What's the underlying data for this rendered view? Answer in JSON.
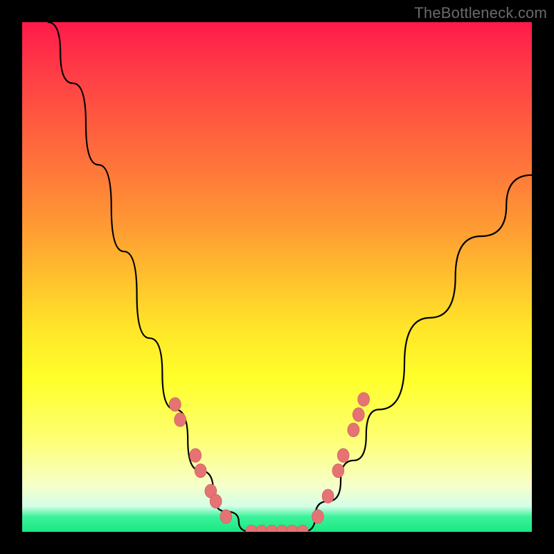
{
  "watermark": "TheBottleneck.com",
  "colors": {
    "background": "#000000",
    "curve_stroke": "#000000",
    "dot_fill": "#e57373",
    "dot_stroke": "#c85a5a"
  },
  "chart_data": {
    "type": "line",
    "title": "",
    "xlabel": "",
    "ylabel": "",
    "xlim": [
      0,
      100
    ],
    "ylim": [
      0,
      100
    ],
    "grid": false,
    "curve_main": [
      {
        "x": 5,
        "y": 100
      },
      {
        "x": 10,
        "y": 88
      },
      {
        "x": 15,
        "y": 72
      },
      {
        "x": 20,
        "y": 55
      },
      {
        "x": 25,
        "y": 38
      },
      {
        "x": 30,
        "y": 24
      },
      {
        "x": 35,
        "y": 12
      },
      {
        "x": 40,
        "y": 4
      },
      {
        "x": 45,
        "y": 0
      },
      {
        "x": 50,
        "y": 0
      },
      {
        "x": 55,
        "y": 0
      },
      {
        "x": 60,
        "y": 6
      },
      {
        "x": 65,
        "y": 14
      },
      {
        "x": 70,
        "y": 24
      },
      {
        "x": 80,
        "y": 42
      },
      {
        "x": 90,
        "y": 58
      },
      {
        "x": 100,
        "y": 70
      }
    ],
    "dots_left": [
      {
        "x": 30,
        "y": 25
      },
      {
        "x": 31,
        "y": 22
      },
      {
        "x": 34,
        "y": 15
      },
      {
        "x": 35,
        "y": 12
      },
      {
        "x": 37,
        "y": 8
      },
      {
        "x": 38,
        "y": 6
      },
      {
        "x": 40,
        "y": 3
      }
    ],
    "dots_bottom": [
      {
        "x": 45,
        "y": 0
      },
      {
        "x": 47,
        "y": 0
      },
      {
        "x": 49,
        "y": 0
      },
      {
        "x": 51,
        "y": 0
      },
      {
        "x": 53,
        "y": 0
      },
      {
        "x": 55,
        "y": 0
      }
    ],
    "dots_right": [
      {
        "x": 58,
        "y": 3
      },
      {
        "x": 60,
        "y": 7
      },
      {
        "x": 62,
        "y": 12
      },
      {
        "x": 63,
        "y": 15
      },
      {
        "x": 65,
        "y": 20
      },
      {
        "x": 66,
        "y": 23
      },
      {
        "x": 67,
        "y": 26
      }
    ]
  }
}
